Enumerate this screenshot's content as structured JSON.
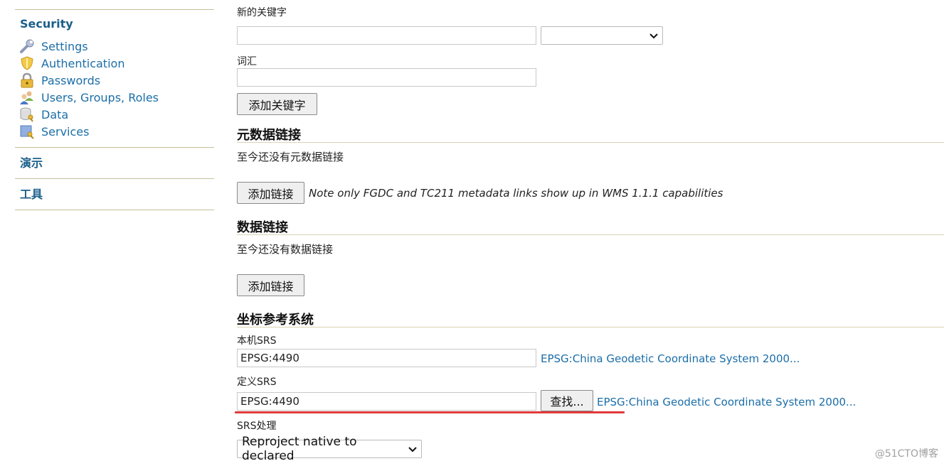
{
  "sidebar": {
    "security_title": "Security",
    "items": [
      {
        "label": "Settings",
        "icon": "wrench-icon"
      },
      {
        "label": "Authentication",
        "icon": "shield-icon"
      },
      {
        "label": "Passwords",
        "icon": "lock-icon"
      },
      {
        "label": "Users, Groups, Roles",
        "icon": "users-icon"
      },
      {
        "label": "Data",
        "icon": "database-key-icon"
      },
      {
        "label": "Services",
        "icon": "services-key-icon"
      }
    ],
    "demo_title": "演示",
    "tools_title": "工具"
  },
  "keywords": {
    "new_keyword_label": "新的关键字",
    "new_keyword_value": "",
    "language_selected": "",
    "vocabulary_label": "词汇",
    "vocabulary_value": "",
    "add_keyword_button": "添加关键字"
  },
  "metadata_links": {
    "title": "元数据链接",
    "empty_text": "至今还没有元数据链接",
    "add_button": "添加链接",
    "note": "Note only FGDC and TC211 metadata links show up in WMS 1.1.1 capabilities"
  },
  "data_links": {
    "title": "数据链接",
    "empty_text": "至今还没有数据链接",
    "add_button": "添加链接"
  },
  "crs": {
    "title": "坐标参考系统",
    "native_label": "本机SRS",
    "native_value": "EPSG:4490",
    "native_link": "EPSG:China Geodetic Coordinate System 2000...",
    "declared_label": "定义SRS",
    "declared_value": "EPSG:4490",
    "find_button": "查找...",
    "declared_link": "EPSG:China Geodetic Coordinate System 2000...",
    "handling_label": "SRS处理",
    "handling_selected": "Reproject native to declared"
  },
  "watermark": "@51CTO博客",
  "colors": {
    "link": "#1b6ea8",
    "sidebar_title": "#1b5f8a",
    "rule": "#c6c09a",
    "annotation_red": "#e0393a"
  }
}
